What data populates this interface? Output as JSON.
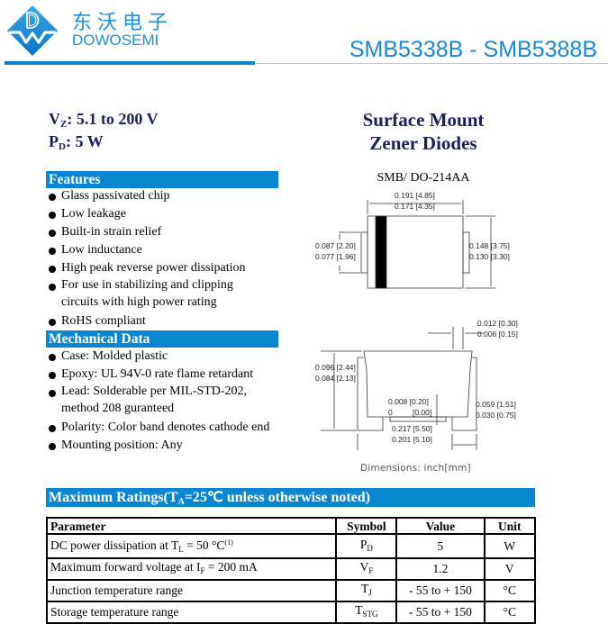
{
  "header": {
    "brand_cn": "东沃电子",
    "brand_en": "DOWOSEMI",
    "logo_letters": "DW",
    "part_range": "SMB5338B - SMB5388B",
    "accent_color": "#0a86d0"
  },
  "specs": {
    "vz_label": "V",
    "vz_sub": "Z",
    "vz_value": ": 5.1 to 200 V",
    "pd_label": "P",
    "pd_sub": "D",
    "pd_value": ": 5 W"
  },
  "product_type": {
    "line1": "Surface Mount",
    "line2": "Zener Diodes"
  },
  "features": {
    "title": "Features",
    "items": [
      "Glass passivated chip",
      "Low leakage",
      "Built-in strain relief",
      "Low inductance",
      "High peak reverse power dissipation",
      "For use in stabilizing and clipping circuits with high power rating",
      "RoHS compliant"
    ]
  },
  "mechanical": {
    "title": "Mechanical Data",
    "items": [
      "Case: Molded plastic",
      "Epoxy: UL 94V-0 rate flame retardant",
      "Lead: Solderable per MIL-STD-202, method 208 guranteed",
      "Polarity: Color band denotes cathode end",
      "Mounting position: Any"
    ]
  },
  "package": {
    "title": "SMB/ DO-214AA",
    "top_view": {
      "width_max": "0.191 [4.85]",
      "width_min": "0.171 [4.35]",
      "lead_max": "0.087 [2.20]",
      "lead_min": "0.077 [1.96]",
      "body_max": "0.148 [3.75]",
      "body_min": "0.130 [3.30]"
    },
    "side_view": {
      "lead_thk_max": "0.012 [0.30]",
      "lead_thk_min": "0.006 [0.15]",
      "height_max": "0.096 [2.44]",
      "height_min": "0.084 [2.13]",
      "standoff_max": "0.008 [0.20]",
      "standoff_min_in": "0",
      "standoff_min_mm": "[0.00]",
      "lead_len_max": "0.059 [1.51]",
      "lead_len_min": "0.030 [0.75]",
      "overall_max": "0.217 [5.50]",
      "overall_min": "0.201 [5.10]"
    },
    "note": "Dimensions: inch[mm]"
  },
  "max_ratings": {
    "title_pre": "Maximum Ratings(T",
    "title_sub": "A",
    "title_post": "=25℃ unless otherwise noted)",
    "headers": [
      "Parameter",
      "Symbol",
      "Value",
      "Unit"
    ],
    "rows": [
      {
        "param": "DC power dissipation at T",
        "param_sub": "L",
        "param_post": " = 50 °C",
        "param_sup": "(1)",
        "sym": "P",
        "sym_sub": "D",
        "value": "5",
        "unit": "W"
      },
      {
        "param": "Maximum forward voltage at I",
        "param_sub": "F",
        "param_post": " = 200 mA",
        "param_sup": "",
        "sym": "V",
        "sym_sub": "F",
        "value": "1.2",
        "unit": "V"
      },
      {
        "param": "Junction temperature range",
        "param_sub": "",
        "param_post": "",
        "param_sup": "",
        "sym": "T",
        "sym_sub": "J",
        "value": "- 55 to + 150",
        "unit": "°C"
      },
      {
        "param": "Storage temperature range",
        "param_sub": "",
        "param_post": "",
        "param_sup": "",
        "sym": "T",
        "sym_sub": "STG",
        "value": "- 55 to + 150",
        "unit": "°C"
      }
    ]
  }
}
